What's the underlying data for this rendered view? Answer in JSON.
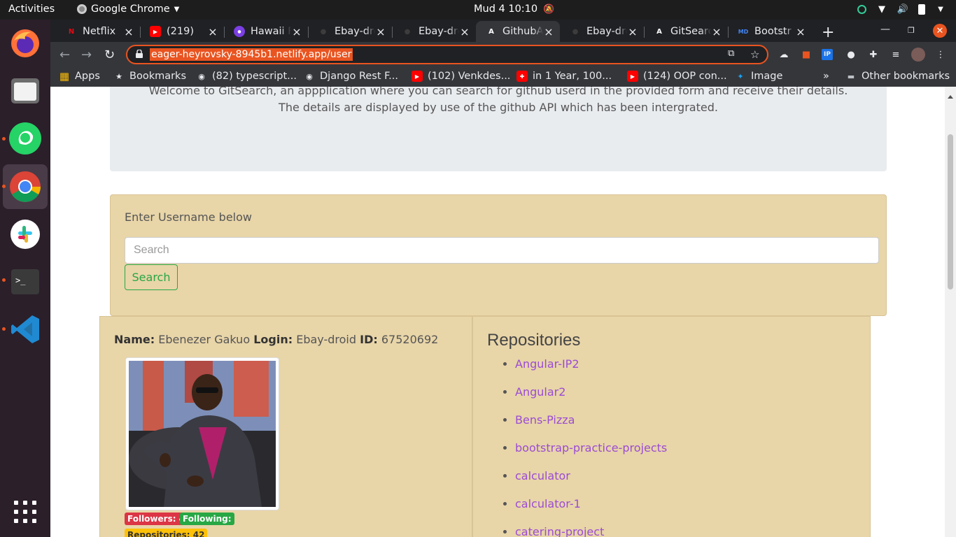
{
  "system": {
    "activities": "Activities",
    "app_name": "Google Chrome",
    "clock": "Mud 4  10:10"
  },
  "tabs": [
    {
      "title": "Netflix",
      "icon": "netflix-icon",
      "color": "#e50914"
    },
    {
      "title": "(219)",
      "icon": "youtube-icon",
      "color": "#ff0000"
    },
    {
      "title": "Hawaii F",
      "icon": "podcast-icon",
      "color": "#7b3fe4"
    },
    {
      "title": "Ebay-dro",
      "icon": "github-icon",
      "color": "#ffffff"
    },
    {
      "title": "Ebay-dro",
      "icon": "github-icon",
      "color": "#ffffff"
    },
    {
      "title": "GithubA",
      "icon": "angular-icon",
      "color": "#ffffff"
    },
    {
      "title": "Ebay-dro",
      "icon": "github-icon",
      "color": "#ffffff"
    },
    {
      "title": "GitSearc",
      "icon": "angular-icon",
      "color": "#ffffff"
    },
    {
      "title": "Bootstr",
      "icon": "mdb-icon",
      "color": "#4285f4"
    }
  ],
  "omnibox": {
    "url": "eager-heyrovsky-8945b1.netlify.app/user"
  },
  "bookmarks": [
    {
      "label": "Apps",
      "icon": "apps-grid-icon"
    },
    {
      "label": "Bookmarks",
      "icon": "star-icon"
    },
    {
      "label": "(82) typescript...",
      "icon": "globe-icon"
    },
    {
      "label": "Django Rest F...",
      "icon": "globe-icon"
    },
    {
      "label": "(102) Venkdes...",
      "icon": "youtube-icon"
    },
    {
      "label": "in 1 Year, 100...",
      "icon": "swiss-flag-icon"
    },
    {
      "label": "(124) OOP con...",
      "icon": "youtube-icon"
    },
    {
      "label": "Image",
      "icon": "twitter-icon"
    },
    {
      "label": "Other bookmarks",
      "icon": "folder-icon"
    }
  ],
  "jumbotron": {
    "text": "Welcome to GitSearch, an appplication where you can search for github userd in the provided form and receive their details. The details are displayed by use of the github API which has been intergrated."
  },
  "search": {
    "label": "Enter Username below",
    "placeholder": "Search",
    "button": "Search"
  },
  "user": {
    "name_label": "Name:",
    "name": "Ebenezer Gakuo",
    "login_label": "Login:",
    "login": "Ebay-droid",
    "id_label": "ID:",
    "id": "67520692",
    "followers": "Followers: 4",
    "following": "Following:",
    "repositories": "Repositories: 42"
  },
  "repos": {
    "title": "Repositories",
    "items": [
      "Angular-IP2",
      "Angular2",
      "Bens-Pizza",
      "bootstrap-practice-projects",
      "calculator",
      "calculator-1",
      "catering-project"
    ]
  },
  "colors": {
    "accent": "#e95420",
    "card": "#e8d5a8",
    "link": "#9b4cd4",
    "success": "#28a745",
    "danger": "#dc3545"
  }
}
